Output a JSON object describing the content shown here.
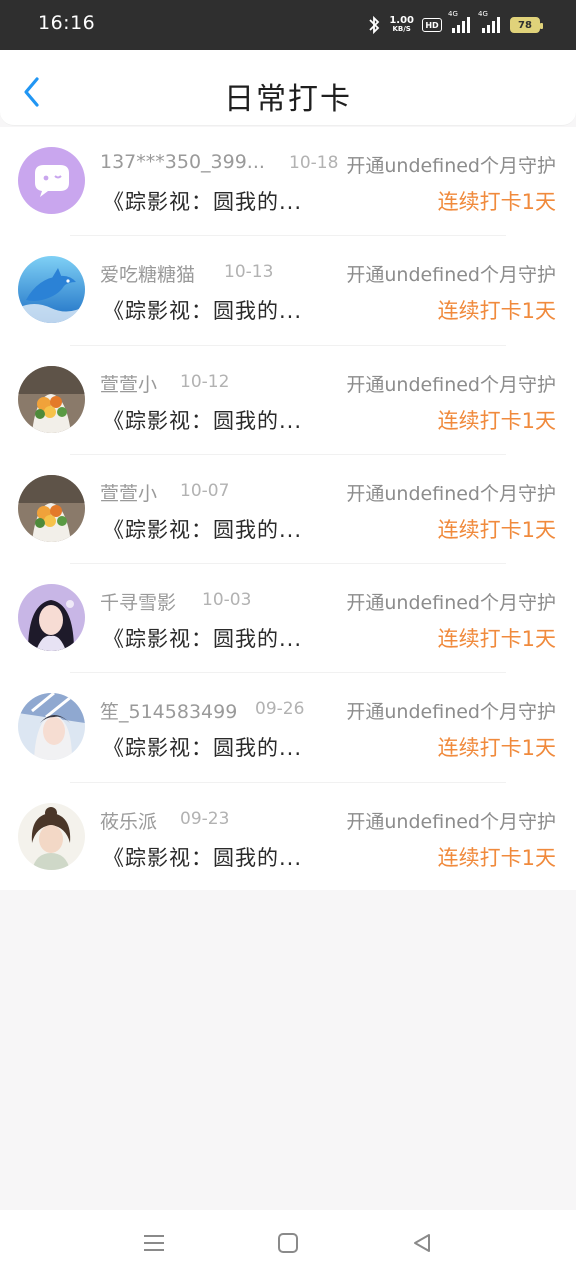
{
  "status_bar": {
    "time": "16:16",
    "net_speed_value": "1.00",
    "net_speed_unit": "KB/S",
    "hd_label": "HD",
    "sim1_label": "4G",
    "sim2_label": "4G",
    "battery": "78"
  },
  "header": {
    "title": "日常打卡",
    "back_icon": "chevron-left-icon",
    "accent_color": "#2196f3"
  },
  "checkins": [
    {
      "name": "137***350_399...",
      "date": "10-18",
      "action": "开通undefined个月守护",
      "work": "《踪影视：圆我的...",
      "streak": "连续打卡1天",
      "avatar": "chat-bubble-avatar"
    },
    {
      "name": "爱吃糖糖猫",
      "date": "10-13",
      "action": "开通undefined个月守护",
      "work": "《踪影视：圆我的...",
      "streak": "连续打卡1天",
      "avatar": "dolphin-avatar"
    },
    {
      "name": "萱萱小",
      "date": "10-12",
      "action": "开通undefined个月守护",
      "work": "《踪影视：圆我的...",
      "streak": "连续打卡1天",
      "avatar": "flower-bouquet-avatar"
    },
    {
      "name": "萱萱小",
      "date": "10-07",
      "action": "开通undefined个月守护",
      "work": "《踪影视：圆我的...",
      "streak": "连续打卡1天",
      "avatar": "flower-bouquet-avatar"
    },
    {
      "name": "千寻雪影",
      "date": "10-03",
      "action": "开通undefined个月守护",
      "work": "《踪影视：圆我的...",
      "streak": "连续打卡1天",
      "avatar": "girl-portrait-avatar"
    },
    {
      "name": "笙_514583499",
      "date": "09-26",
      "action": "开通undefined个月守护",
      "work": "《踪影视：圆我的...",
      "streak": "连续打卡1天",
      "avatar": "girl-hat-avatar"
    },
    {
      "name": "莜乐派",
      "date": "09-23",
      "action": "开通undefined个月守护",
      "work": "《踪影视：圆我的...",
      "streak": "连续打卡1天",
      "avatar": "illustrated-girl-avatar"
    }
  ],
  "colors": {
    "streak": "#f08a3c",
    "page_background": "#f7f6f7"
  },
  "bottom_nav": {
    "menu_icon": "menu-icon",
    "home_icon": "home-square-icon",
    "back_icon": "back-triangle-icon"
  }
}
